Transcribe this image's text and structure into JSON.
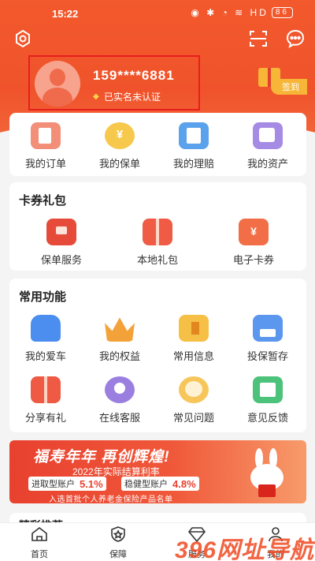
{
  "statusbar": {
    "time": "15:22",
    "battery": "86",
    "icons": "◉ ✱ ◔ ≋ HD"
  },
  "profile": {
    "phone": "159****6881",
    "verify_status": "已实名未认证"
  },
  "signin": {
    "label": "签到"
  },
  "orders": {
    "items": [
      {
        "label": "我的订单",
        "icon": "order-icon"
      },
      {
        "label": "我的保单",
        "icon": "policy-icon"
      },
      {
        "label": "我的理赔",
        "icon": "claim-icon"
      },
      {
        "label": "我的资产",
        "icon": "assets-icon"
      }
    ]
  },
  "coupons": {
    "title": "卡券礼包",
    "items": [
      {
        "label": "保单服务",
        "icon": "policy-service-icon"
      },
      {
        "label": "本地礼包",
        "icon": "gift-box-icon"
      },
      {
        "label": "电子卡券",
        "icon": "coupon-icon"
      }
    ]
  },
  "functions": {
    "title": "常用功能",
    "items": [
      {
        "label": "我的爱车",
        "icon": "car-icon"
      },
      {
        "label": "我的权益",
        "icon": "crown-icon"
      },
      {
        "label": "常用信息",
        "icon": "folder-icon"
      },
      {
        "label": "投保暂存",
        "icon": "save-icon"
      },
      {
        "label": "分享有礼",
        "icon": "share-gift-icon"
      },
      {
        "label": "在线客服",
        "icon": "customer-service-icon"
      },
      {
        "label": "常见问题",
        "icon": "faq-icon"
      },
      {
        "label": "意见反馈",
        "icon": "feedback-icon"
      }
    ]
  },
  "banner": {
    "title": "福寿年年 再创辉煌!",
    "subtitle": "2022年实际结算利率",
    "rate1_label": "进取型账户",
    "rate1_value": "5.1%",
    "rate2_label": "稳健型账户",
    "rate2_value": "4.8%",
    "note": "入选首批个人养老金保险产品名单"
  },
  "next_section": {
    "title": "精彩推荐"
  },
  "tabbar": {
    "tabs": [
      {
        "label": "首页",
        "icon": "home-icon"
      },
      {
        "label": "保障",
        "icon": "shield-star-icon"
      },
      {
        "label": "服务",
        "icon": "diamond-icon"
      },
      {
        "label": "我的",
        "icon": "user-icon"
      }
    ]
  },
  "watermark": "396网址导航",
  "colors": {
    "header": "#f2592c",
    "accent": "#e8412f",
    "highlight_box": "#e81e1e"
  }
}
